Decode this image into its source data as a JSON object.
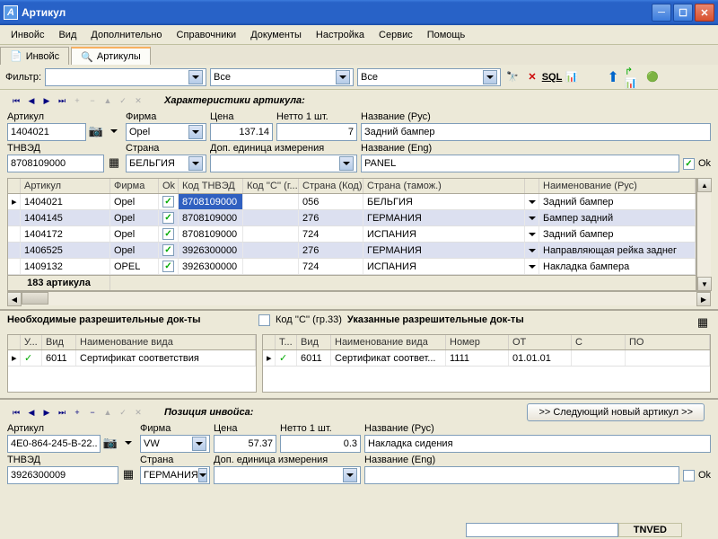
{
  "window": {
    "title": "Артикул"
  },
  "menu": [
    "Инвойс",
    "Вид",
    "Дополнительно",
    "Справочники",
    "Документы",
    "Настройка",
    "Сервис",
    "Помощь"
  ],
  "tabs": [
    {
      "label": "Инвойс",
      "active": false
    },
    {
      "label": "Артикулы",
      "active": true
    }
  ],
  "filter": {
    "label": "Фильтр:",
    "combo1": "",
    "combo2": "Все",
    "combo3": "Все"
  },
  "section_char": "Характеристики артикула:",
  "form1": {
    "artikul": {
      "label": "Артикул",
      "value": "1404021"
    },
    "firma": {
      "label": "Фирма",
      "value": "Opel"
    },
    "cena": {
      "label": "Цена",
      "value": "137.14"
    },
    "netto": {
      "label": "Нетто 1 шт.",
      "value": "7"
    },
    "nazv_rus": {
      "label": "Название (Рус)",
      "value": "Задний бампер"
    },
    "tnved": {
      "label": "ТНВЭД",
      "value": "8708109000"
    },
    "strana": {
      "label": "Страна",
      "value": "БЕЛЬГИЯ"
    },
    "dop": {
      "label": "Доп. единица измерения",
      "value": ""
    },
    "nazv_eng": {
      "label": "Название (Eng)",
      "value": "PANEL"
    },
    "ok": "Ok"
  },
  "grid1": {
    "headers": [
      "",
      "Артикул",
      "Фирма",
      "Ok",
      "Код ТНВЭД",
      "Код ''С'' (г...",
      "Страна (Код)",
      "Страна (тамож.)",
      "",
      "Наименование (Рус)"
    ],
    "rows": [
      {
        "mark": "▸",
        "artikul": "1404021",
        "firma": "Opel",
        "ok": true,
        "tnved": "8708109000",
        "codc": "",
        "skod": "056",
        "stam": "БЕЛЬГИЯ",
        "naim": "Задний бампер",
        "sel": true
      },
      {
        "mark": "",
        "artikul": "1404145",
        "firma": "Opel",
        "ok": true,
        "tnved": "8708109000",
        "codc": "",
        "skod": "276",
        "stam": "ГЕРМАНИЯ",
        "naim": "Бампер задний"
      },
      {
        "mark": "",
        "artikul": "1404172",
        "firma": "Opel",
        "ok": true,
        "tnved": "8708109000",
        "codc": "",
        "skod": "724",
        "stam": "ИСПАНИЯ",
        "naim": "Задний бампер"
      },
      {
        "mark": "",
        "artikul": "1406525",
        "firma": "Opel",
        "ok": true,
        "tnved": "3926300000",
        "codc": "",
        "skod": "276",
        "stam": "ГЕРМАНИЯ",
        "naim": "Направляющая рейка заднег"
      },
      {
        "mark": "",
        "artikul": "1409132",
        "firma": "OPEL",
        "ok": true,
        "tnved": "3926300000",
        "codc": "",
        "skod": "724",
        "stam": "ИСПАНИЯ",
        "naim": "Накладка бампера"
      }
    ],
    "footer": "183 артикула"
  },
  "docs": {
    "left_title": "Необходимые разрешительные док-ты",
    "cod_c": "Код ''С'' (гр.33)",
    "right_title": "Указанные разрешительные док-ты",
    "left_headers": [
      "У...",
      "Вид",
      "Наименование вида"
    ],
    "right_headers": [
      "Т...",
      "Вид",
      "Наименование вида",
      "Номер",
      "ОТ",
      "С",
      "ПО"
    ],
    "left_row": {
      "vid": "6011",
      "naim": "Сертификат соответствия"
    },
    "right_row": {
      "vid": "6011",
      "naim": "Сертификат соответ...",
      "nomer": "1111",
      "ot": "01.01.01",
      "s": "",
      "po": ""
    }
  },
  "section_inv": "Позиция инвойса:",
  "next_btn": ">>  Следующий новый артикул >>",
  "form2": {
    "artikul": {
      "label": "Артикул",
      "value": "4E0-864-245-B-22..."
    },
    "firma": {
      "label": "Фирма",
      "value": "VW"
    },
    "cena": {
      "label": "Цена",
      "value": "57.37"
    },
    "netto": {
      "label": "Нетто 1 шт.",
      "value": "0.3"
    },
    "nazv_rus": {
      "label": "Название (Рус)",
      "value": "Накладка сидения"
    },
    "tnved": {
      "label": "ТНВЭД",
      "value": "3926300009"
    },
    "strana": {
      "label": "Страна",
      "value": "ГЕРМАНИЯ"
    },
    "dop": {
      "label": "Доп. единица измерения",
      "value": ""
    },
    "nazv_eng": {
      "label": "Название (Eng)",
      "value": ""
    },
    "ok": "Ok"
  },
  "status": {
    "label": "TNVED"
  }
}
